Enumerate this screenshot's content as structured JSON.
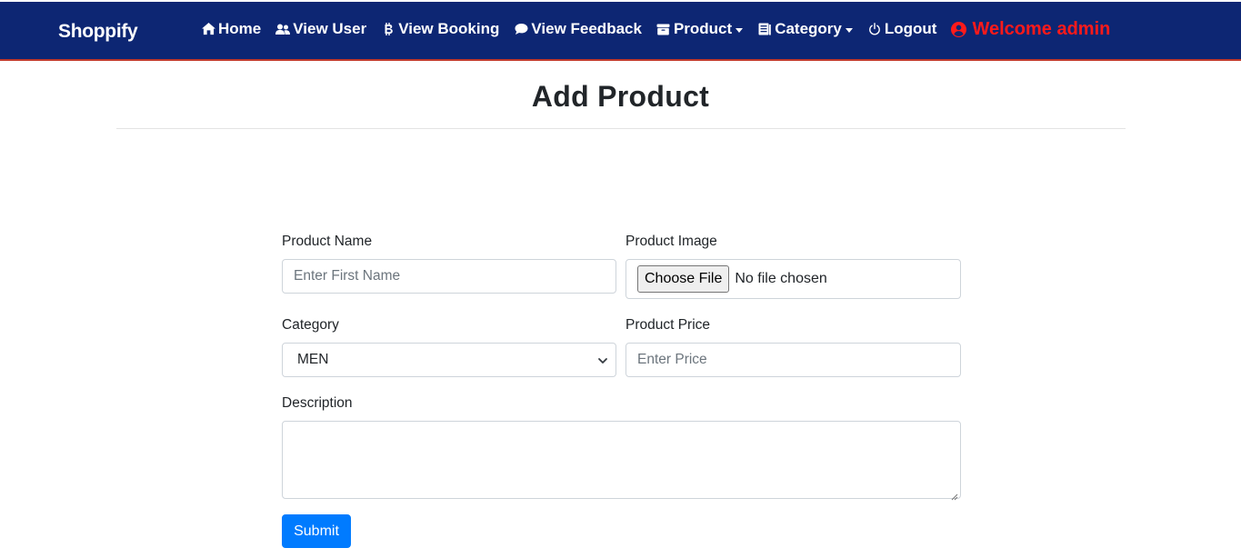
{
  "navbar": {
    "brand": "Shoppify",
    "bg_color": "#0d2673",
    "items": [
      {
        "label": "Home",
        "icon": "home-icon",
        "dropdown": false
      },
      {
        "label": "View User",
        "icon": "users-icon",
        "dropdown": false
      },
      {
        "label": "View Booking",
        "icon": "bitcoin-icon",
        "dropdown": false
      },
      {
        "label": "View Feedback",
        "icon": "chat-bubble-icon",
        "dropdown": false
      },
      {
        "label": "Product",
        "icon": "box-icon",
        "dropdown": true
      },
      {
        "label": "Category",
        "icon": "list-icon",
        "dropdown": true
      },
      {
        "label": "Logout",
        "icon": "power-icon",
        "dropdown": false
      }
    ],
    "welcome": {
      "label": "Welcome admin",
      "icon": "user-circle-icon",
      "color": "#ff1a1a"
    }
  },
  "page": {
    "title": "Add Product"
  },
  "form": {
    "product_name": {
      "label": "Product Name",
      "placeholder": "Enter First Name",
      "value": ""
    },
    "product_image": {
      "label": "Product Image",
      "button": "Choose File",
      "status": "No file chosen"
    },
    "category": {
      "label": "Category",
      "selected": "MEN"
    },
    "product_price": {
      "label": "Product Price",
      "placeholder": "Enter Price",
      "value": ""
    },
    "description": {
      "label": "Description",
      "value": ""
    },
    "submit": {
      "label": "Submit",
      "color": "#007bff"
    }
  }
}
